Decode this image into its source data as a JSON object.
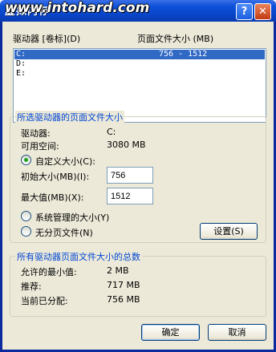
{
  "window": {
    "title": "虚拟内存",
    "watermark": "www.intohard.com",
    "help_glyph": "?",
    "close_glyph": "✕"
  },
  "drive_list": {
    "header_drive": "驱动器 [卷标](D)",
    "header_size": "页面文件大小 (MB)",
    "rows": [
      {
        "drive": "C:",
        "size": "756 - 1512",
        "selected": true
      },
      {
        "drive": "D:",
        "size": "",
        "selected": false
      },
      {
        "drive": "E:",
        "size": "",
        "selected": false
      }
    ]
  },
  "selected_drive": {
    "group_title": "所选驱动器的页面文件大小",
    "drive_label": "驱动器:",
    "drive_value": "C:",
    "free_label": "可用空间:",
    "free_value": "3080 MB",
    "custom_label": "自定义大小(C):",
    "custom_checked": true,
    "initial_label": "初始大小(MB)(I):",
    "initial_value": "756",
    "max_label": "最大值(MB)(X):",
    "max_value": "1512",
    "system_managed_label": "系统管理的大小(Y)",
    "no_paging_label": "无分页文件(N)",
    "set_button": "设置(S)"
  },
  "totals": {
    "group_title": "所有驱动器页面文件大小的总数",
    "min_label": "允许的最小值:",
    "min_value": "2 MB",
    "recommended_label": "推荐:",
    "recommended_value": "717 MB",
    "allocated_label": "当前已分配:",
    "allocated_value": "756 MB"
  },
  "buttons": {
    "ok": "确定",
    "cancel": "取消"
  }
}
